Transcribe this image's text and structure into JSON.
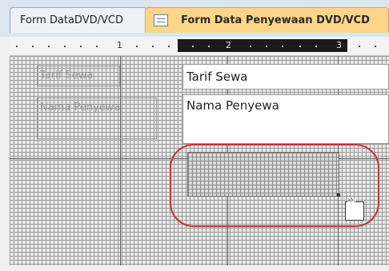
{
  "tabs": [
    {
      "label": "Form DataDVD/VCD",
      "active": false
    },
    {
      "label": "Form Data Penyewaan DVD/VCD",
      "active": true,
      "icon": "form-icon"
    }
  ],
  "ruler": {
    "marks": [
      "1",
      "2",
      "3"
    ]
  },
  "form": {
    "fields": [
      {
        "label": "Tarif Sewa",
        "value": "Tarif Sewa"
      },
      {
        "label": "Nama Penyewa",
        "value": "Nama Penyewa"
      }
    ],
    "new_control_tag": "ab|"
  },
  "colors": {
    "tab_active": "#fbd68a",
    "highlight_ellipse": "#c8323c",
    "grid_background": "#e8e8e8"
  }
}
